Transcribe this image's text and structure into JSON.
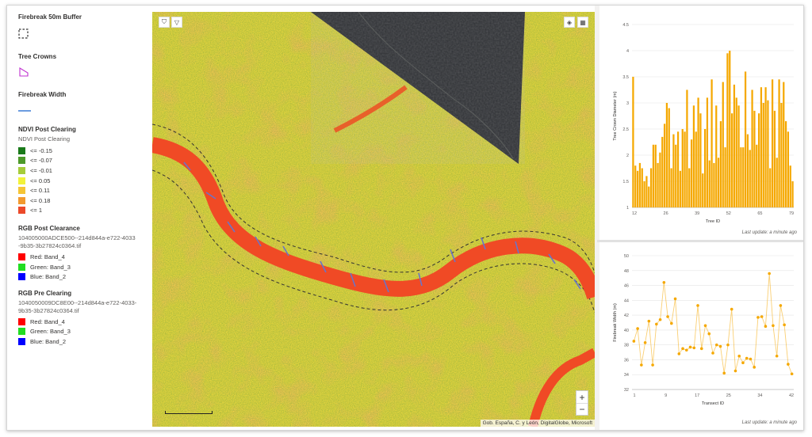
{
  "legend": {
    "buffer_title": "Firebreak 50m Buffer",
    "crowns_title": "Tree Crowns",
    "width_title": "Firebreak Width",
    "ndvi_title": "NDVI Post Clearing",
    "ndvi_subtitle": "NDVI Post Clearing",
    "ndvi_classes": [
      {
        "label": "<= -0.15",
        "color": "#1a7a1a"
      },
      {
        "label": "<= -0.07",
        "color": "#4d9a2a"
      },
      {
        "label": "<= -0.01",
        "color": "#a6cc3a"
      },
      {
        "label": "<= 0.05",
        "color": "#f2f23a"
      },
      {
        "label": "<= 0.11",
        "color": "#f5c535"
      },
      {
        "label": "<= 0.18",
        "color": "#f29a2e"
      },
      {
        "label": "<= 1",
        "color": "#ec4a2a"
      }
    ],
    "rgb_post_title": "RGB Post Clearance",
    "rgb_post_file": "104005000ADCE500--214d844a-e722-4033-9b35-3b27824c0364.tif",
    "rgb_post_bands": [
      {
        "label": "Red: Band_4",
        "color": "#ff0000"
      },
      {
        "label": "Green: Band_3",
        "color": "#22dd22"
      },
      {
        "label": "Blue: Band_2",
        "color": "#0000ff"
      }
    ],
    "rgb_pre_title": "RGB Pre Clearing",
    "rgb_pre_file": "1040050009DC8E00--214d844a-e722-4033-9b35-3b27824c0364.tif",
    "rgb_pre_bands": [
      {
        "label": "Red: Band_4",
        "color": "#ff0000"
      },
      {
        "label": "Green: Band_3",
        "color": "#22dd22"
      },
      {
        "label": "Blue: Band_2",
        "color": "#0000ff"
      }
    ]
  },
  "map": {
    "attribution": "Gob. España, C. y León, DigitalGlobe, Microsoft",
    "zoom_in": "+",
    "zoom_out": "−",
    "tools": [
      "filter-icon",
      "funnel-icon"
    ],
    "tools_right": [
      "layers-icon",
      "qr-icon"
    ]
  },
  "chart_data": [
    {
      "type": "bar",
      "xlabel": "Tree ID",
      "ylabel": "Tree Crown Diameter (m)",
      "ylim": [
        1,
        4.5
      ],
      "yticks": [
        1,
        1.5,
        2,
        2.5,
        3,
        3.5,
        4,
        4.5
      ],
      "xtick_labels": [
        "12",
        "26",
        "39",
        "52",
        "65",
        "79"
      ],
      "color": "#f5a800",
      "values": [
        3.5,
        1.8,
        1.7,
        1.85,
        1.75,
        1.5,
        1.6,
        1.4,
        1.75,
        2.2,
        2.2,
        1.85,
        2.05,
        2.35,
        2.6,
        3.0,
        2.9,
        1.75,
        2.4,
        2.2,
        2.45,
        1.7,
        2.5,
        2.45,
        3.25,
        1.75,
        2.3,
        2.95,
        2.45,
        3.1,
        2.8,
        1.65,
        2.5,
        3.1,
        1.9,
        3.45,
        1.85,
        2.95,
        1.95,
        2.65,
        3.4,
        2.15,
        3.95,
        4.0,
        2.8,
        3.35,
        3.1,
        2.95,
        2.15,
        2.15,
        3.6,
        2.4,
        2.1,
        3.25,
        2.85,
        2.2,
        2.8,
        3.3,
        3.0,
        3.3,
        3.05,
        1.75,
        3.45,
        2.85,
        1.95,
        3.45,
        3.0,
        3.4,
        2.65,
        2.45,
        1.8,
        1.5
      ],
      "footer": "Last update: a minute ago"
    },
    {
      "type": "line",
      "xlabel": "Transect ID",
      "ylabel": "Firebreak Width (m)",
      "ylim": [
        32,
        50
      ],
      "yticks": [
        32,
        34,
        36,
        38,
        40,
        42,
        44,
        46,
        48,
        50
      ],
      "xtick_labels": [
        "1",
        "9",
        "17",
        "25",
        "34",
        "42"
      ],
      "color": "#f5a800",
      "values": [
        38.5,
        40.2,
        35.3,
        38.3,
        41.2,
        35.3,
        40.8,
        41.4,
        46.4,
        41.8,
        40.9,
        44.2,
        36.8,
        37.5,
        37.3,
        37.7,
        37.6,
        43.3,
        37.5,
        40.6,
        39.5,
        36.9,
        38.0,
        37.8,
        34.2,
        38.0,
        42.8,
        34.5,
        36.5,
        35.6,
        36.2,
        36.1,
        35.0,
        41.7,
        41.8,
        40.5,
        47.6,
        40.6,
        36.5,
        43.3,
        40.7,
        35.4,
        34.1
      ],
      "footer": "Last update: a minute ago"
    }
  ]
}
